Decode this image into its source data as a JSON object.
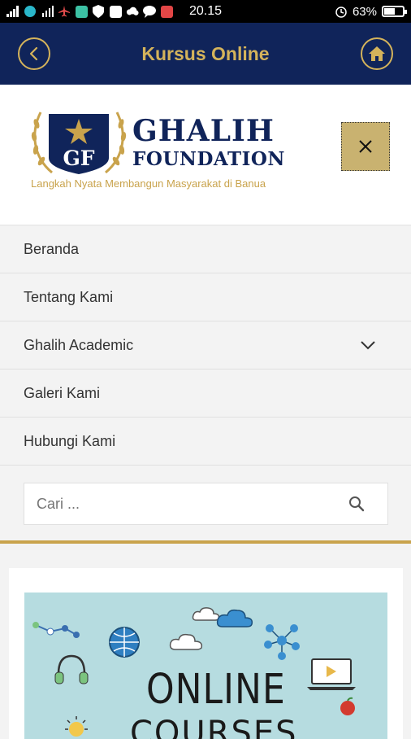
{
  "status_bar": {
    "time": "20.15",
    "battery_percent_label": "63%",
    "battery_level": 0.63
  },
  "app_bar": {
    "title": "Kursus Online"
  },
  "logo": {
    "monogram": "GF",
    "line1": "GHALIH",
    "line2": "FOUNDATION",
    "tagline": "Langkah Nyata Membangun Masyarakat di Banua"
  },
  "menu": {
    "items": [
      {
        "label": "Beranda"
      },
      {
        "label": "Tentang Kami"
      },
      {
        "label": "Ghalih Academic"
      },
      {
        "label": "Galeri Kami"
      },
      {
        "label": "Hubungi Kami"
      }
    ]
  },
  "search": {
    "placeholder": "Cari ..."
  },
  "banner": {
    "line1": "ONLINE",
    "line2": "COURSES"
  },
  "colors": {
    "navy": "#10245a",
    "gold": "#d4b35b",
    "close_button": "#c9b270"
  }
}
